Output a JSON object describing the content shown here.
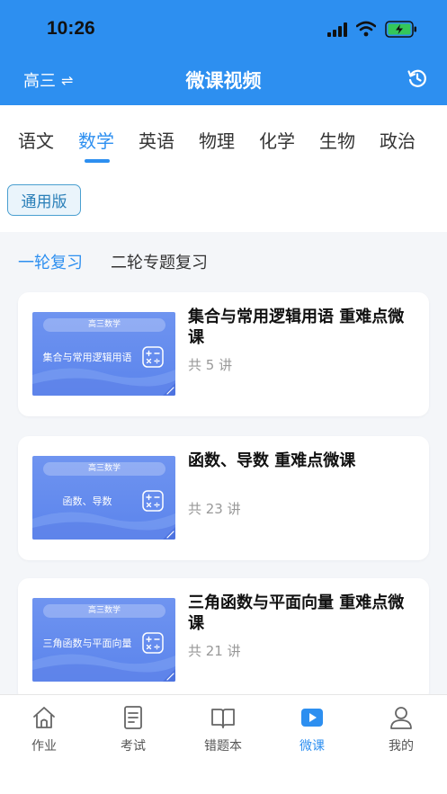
{
  "status_bar": {
    "time": "10:26"
  },
  "nav": {
    "grade": "高三",
    "swap_symbol": "⇌",
    "title": "微课视频"
  },
  "subjects": [
    "语文",
    "数学",
    "英语",
    "物理",
    "化学",
    "生物",
    "政治"
  ],
  "active_subject": "数学",
  "version_chip": "通用版",
  "review_tabs": [
    "一轮复习",
    "二轮专题复习"
  ],
  "active_review_tab": "一轮复习",
  "courses": [
    {
      "thumb_tag": "高三数学",
      "thumb_title": "集合与常用逻辑用语",
      "title": "集合与常用逻辑用语 重难点微课",
      "count": "共 5 讲"
    },
    {
      "thumb_tag": "高三数学",
      "thumb_title": "函数、导数",
      "title": "函数、导数 重难点微课",
      "count": "共 23 讲"
    },
    {
      "thumb_tag": "高三数学",
      "thumb_title": "三角函数与平面向量",
      "title": "三角函数与平面向量 重难点微课",
      "count": "共 21 讲"
    }
  ],
  "bottom_nav": [
    {
      "label": "作业",
      "icon": "home-icon"
    },
    {
      "label": "考试",
      "icon": "document-icon"
    },
    {
      "label": "错题本",
      "icon": "book-icon"
    },
    {
      "label": "微课",
      "icon": "play-icon"
    },
    {
      "label": "我的",
      "icon": "person-icon"
    }
  ],
  "colors": {
    "accent": "#2d8ff0",
    "header_bg": "#2d8ff0",
    "thumb_blue": "#6f94f0"
  }
}
